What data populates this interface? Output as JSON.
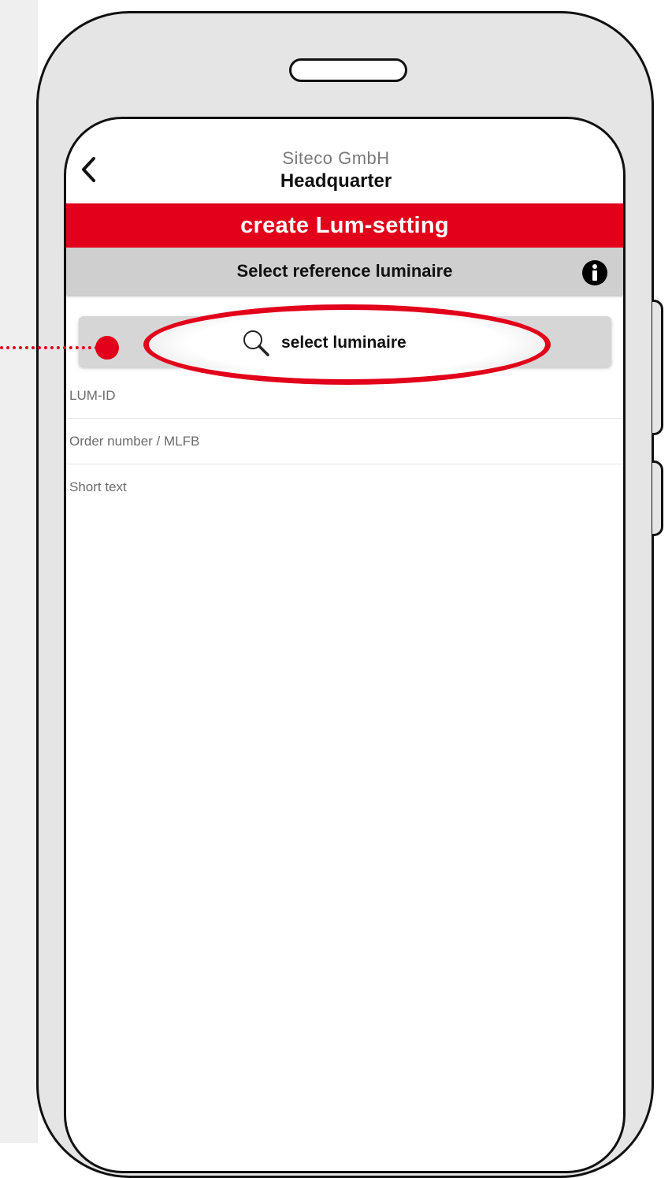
{
  "header": {
    "company": "Siteco GmbH",
    "site": "Headquarter"
  },
  "title_bar": {
    "label": "create Lum-setting",
    "color": "#e2001a"
  },
  "section_bar": {
    "label": "Select reference luminaire"
  },
  "select_button": {
    "label": "select luminaire",
    "icon": "search-icon"
  },
  "fields": [
    {
      "label": "LUM-ID"
    },
    {
      "label": "Order number / MLFB"
    },
    {
      "label": "Short text"
    }
  ],
  "icons": {
    "back": "chevron-left-icon",
    "info": "info-icon"
  },
  "accent_color": "#e2001a"
}
